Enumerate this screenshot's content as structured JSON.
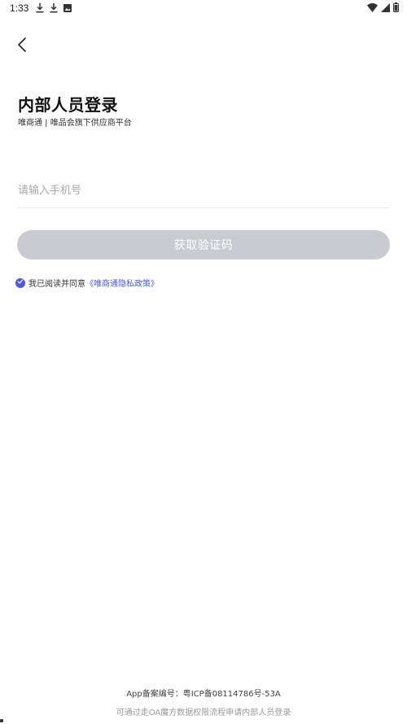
{
  "status_bar": {
    "time": "1:33",
    "icons_left": [
      "download-icon",
      "download-icon",
      "image-icon"
    ],
    "icons_right": [
      "wifi-icon",
      "signal-icon",
      "battery-icon"
    ]
  },
  "header": {
    "back_icon": "chevron-left-icon",
    "title": "内部人员登录",
    "subtitle": "唯商通 | 唯品会旗下供应商平台"
  },
  "form": {
    "phone_placeholder": "请输入手机号",
    "phone_value": "",
    "get_code_label": "获取验证码",
    "agreement_prefix": "我已阅读并同意",
    "privacy_link": "《唯商通隐私政策》",
    "agreement_checked": true
  },
  "footer": {
    "icp": "App备案编号：粤ICP备08114786号-53A",
    "hint": "可通过走OA魔方数据权限流程申请内部人员登录"
  },
  "colors": {
    "accent": "#4b58e0",
    "button_disabled": "#cacbd0",
    "placeholder": "#a7a7ad",
    "divider": "#ececef"
  }
}
